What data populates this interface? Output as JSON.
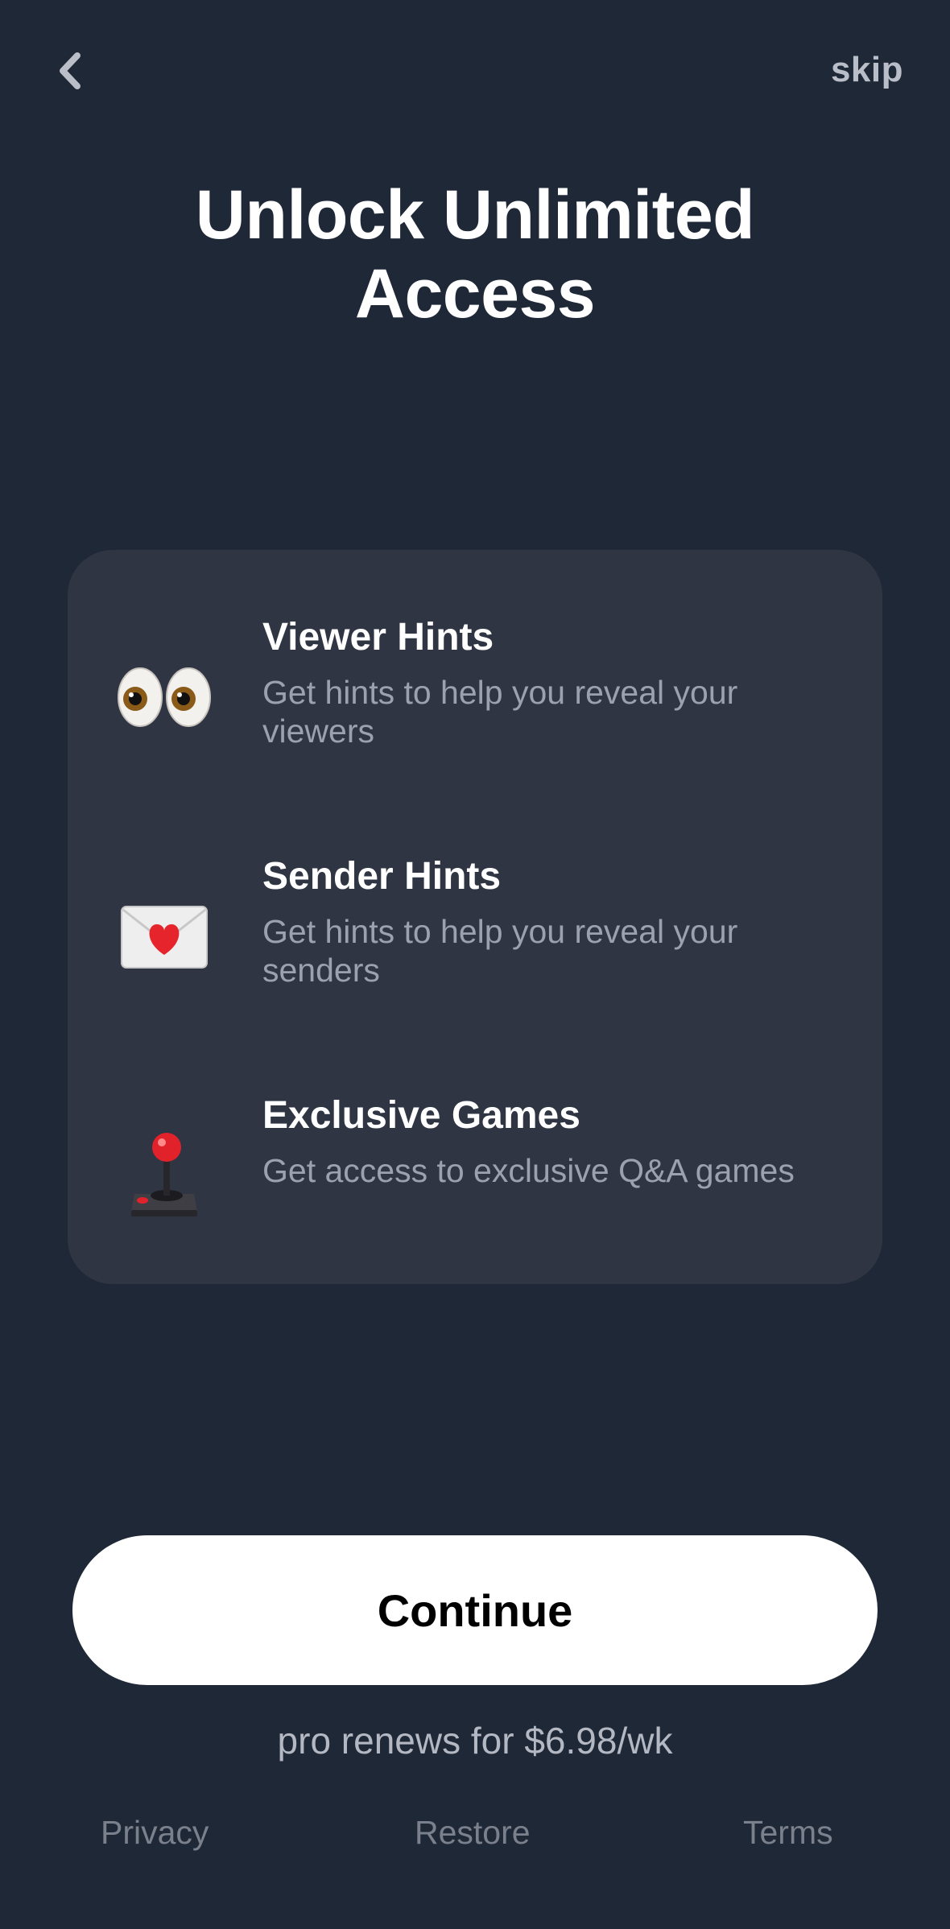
{
  "header": {
    "back_icon": "chevron-left-icon",
    "skip_label": "skip"
  },
  "title": {
    "line1": "Unlock Unlimited",
    "line2": "Access"
  },
  "features": [
    {
      "icon": "eyes-icon",
      "title": "Viewer Hints",
      "description": "Get hints to help you reveal your viewers"
    },
    {
      "icon": "love-letter-icon",
      "title": "Sender Hints",
      "description": "Get hints to help you reveal your senders"
    },
    {
      "icon": "joystick-icon",
      "title": "Exclusive Games",
      "description": "Get access to exclusive Q&A games"
    }
  ],
  "cta": {
    "continue_label": "Continue",
    "renew_text": "pro renews for $6.98/wk"
  },
  "footer": {
    "privacy": "Privacy",
    "restore": "Restore",
    "terms": "Terms"
  },
  "colors": {
    "background": "#1f2837",
    "card": "#2f3543",
    "button": "#ffffff",
    "secondary_text": "#9ba1ad"
  }
}
